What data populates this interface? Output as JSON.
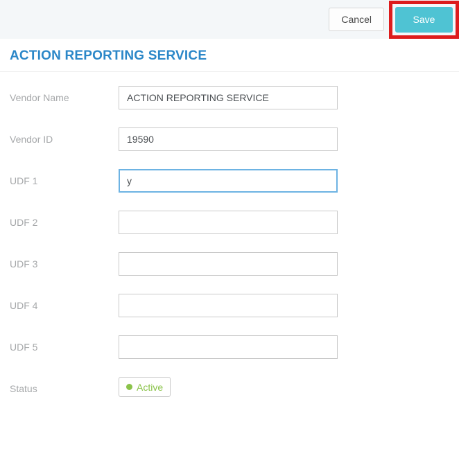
{
  "toolbar": {
    "cancel_label": "Cancel",
    "save_label": "Save"
  },
  "page": {
    "title": "ACTION REPORTING SERVICE"
  },
  "form": {
    "fields": [
      {
        "label": "Vendor Name",
        "value": "ACTION REPORTING SERVICE",
        "state": "normal"
      },
      {
        "label": "Vendor ID",
        "value": "19590",
        "state": "normal"
      },
      {
        "label": "UDF 1",
        "value": "y",
        "state": "focused"
      },
      {
        "label": "UDF 2",
        "value": "",
        "state": "normal"
      },
      {
        "label": "UDF 3",
        "value": "",
        "state": "normal"
      },
      {
        "label": "UDF 4",
        "value": "",
        "state": "normal"
      },
      {
        "label": "UDF 5",
        "value": "",
        "state": "normal"
      }
    ],
    "status": {
      "label": "Status",
      "value": "Active"
    }
  },
  "icons": {
    "status_dot": "circle-dot"
  },
  "colors": {
    "save_button": "#4fc3d3",
    "title_blue": "#2b87c8",
    "active_green": "#8bc34a",
    "annotation_red": "#dd1c1c",
    "focus_border": "#6db3e3",
    "topbar_bg": "#f4f7f9",
    "label_gray": "#a6a8aa"
  }
}
